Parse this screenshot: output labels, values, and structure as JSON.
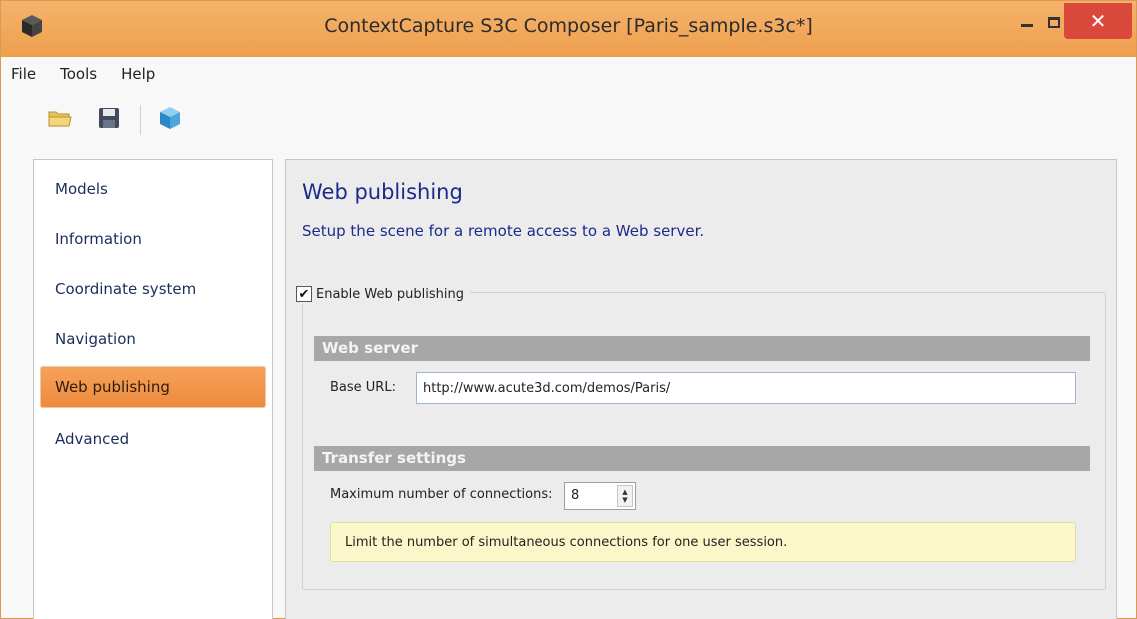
{
  "window": {
    "title": "ContextCapture S3C Composer [Paris_sample.s3c*]",
    "close_glyph": "✕",
    "accent_color": "#ee9f4e",
    "close_color": "#d9483b"
  },
  "menu": {
    "items": [
      {
        "label": "File"
      },
      {
        "label": "Tools"
      },
      {
        "label": "Help"
      }
    ]
  },
  "toolbar": {
    "buttons": [
      {
        "icon": "open-folder-icon"
      },
      {
        "icon": "save-icon"
      },
      {
        "icon": "preview-3d-icon"
      }
    ]
  },
  "sidebar": {
    "items": [
      {
        "label": "Models"
      },
      {
        "label": "Information"
      },
      {
        "label": "Coordinate system"
      },
      {
        "label": "Navigation"
      },
      {
        "label": "Web publishing",
        "active": true
      },
      {
        "label": "Advanced"
      }
    ]
  },
  "main": {
    "title": "Web publishing",
    "subtitle": "Setup the scene for a remote access to a Web server.",
    "enable_label": "Enable Web publishing",
    "enable_checked": true,
    "web_server": {
      "header": "Web server",
      "base_url_label": "Base URL:",
      "base_url_value": "http://www.acute3d.com/demos/Paris/"
    },
    "transfer": {
      "header": "Transfer settings",
      "max_conn_label": "Maximum number of connections:",
      "max_conn_value": "8",
      "hint": "Limit the number of simultaneous connections for one user session."
    }
  }
}
